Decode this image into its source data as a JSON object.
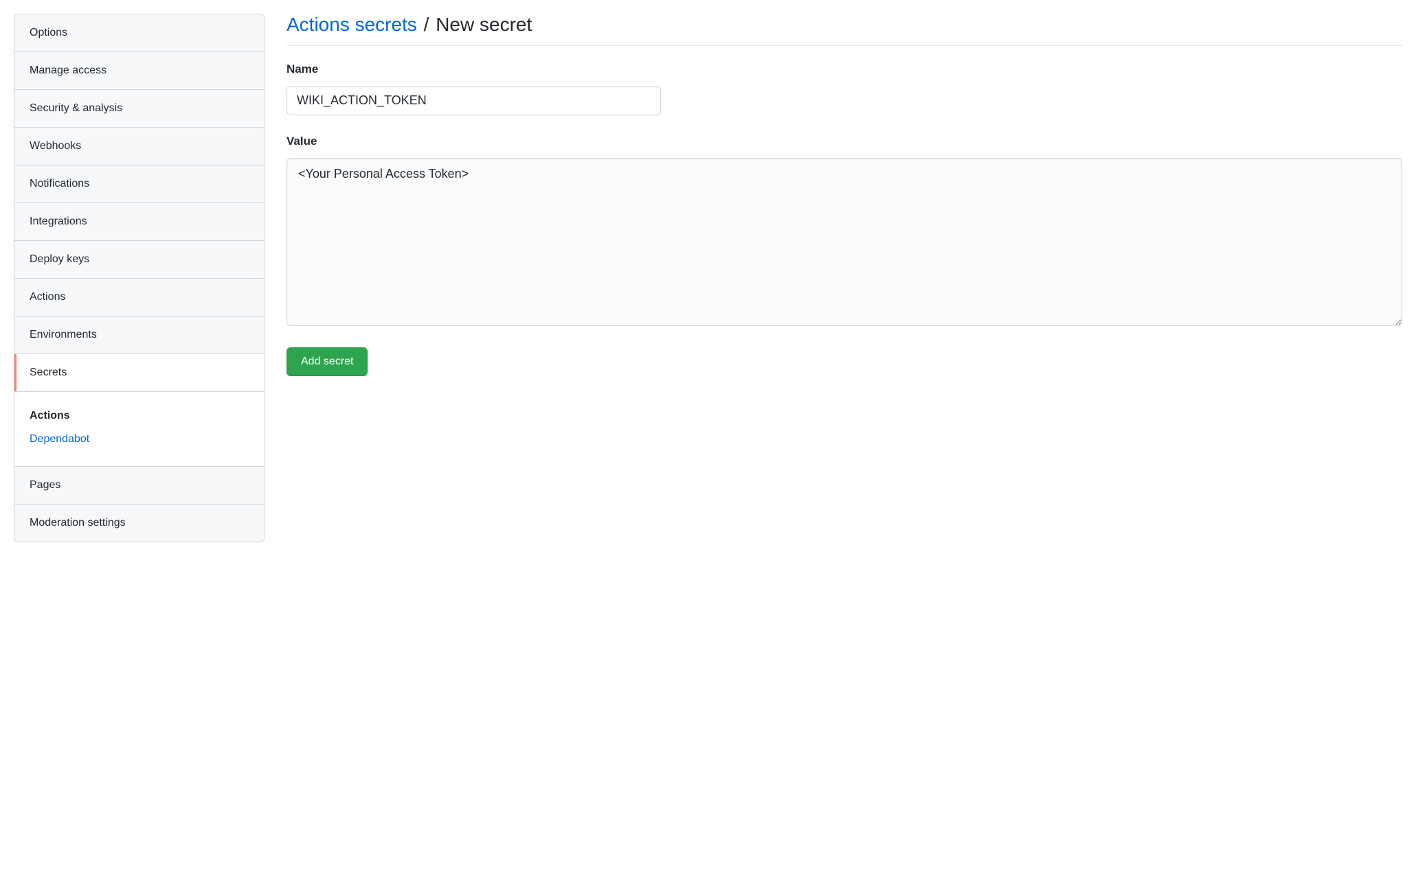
{
  "sidebar": {
    "items": [
      {
        "label": "Options"
      },
      {
        "label": "Manage access"
      },
      {
        "label": "Security & analysis"
      },
      {
        "label": "Webhooks"
      },
      {
        "label": "Notifications"
      },
      {
        "label": "Integrations"
      },
      {
        "label": "Deploy keys"
      },
      {
        "label": "Actions"
      },
      {
        "label": "Environments"
      },
      {
        "label": "Secrets"
      },
      {
        "label": "Pages"
      },
      {
        "label": "Moderation settings"
      }
    ],
    "secrets_submenu": {
      "actions": "Actions",
      "dependabot": "Dependabot"
    }
  },
  "header": {
    "breadcrumb_link": "Actions secrets",
    "separator": "/",
    "current": "New secret"
  },
  "form": {
    "name_label": "Name",
    "name_value": "WIKI_ACTION_TOKEN",
    "value_label": "Value",
    "value_content": "<Your Personal Access Token>",
    "submit_label": "Add secret"
  }
}
